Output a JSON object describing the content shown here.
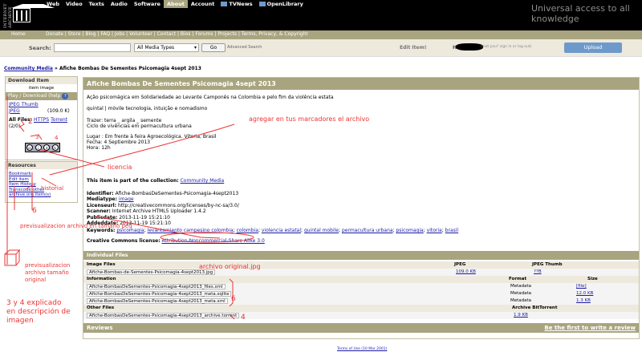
{
  "logo": {
    "vertical_text": "INTERNET ARCHIVE"
  },
  "nav": [
    "Web",
    "Video",
    "Texts",
    "Audio",
    "Software",
    "About",
    "Account",
    "TVNews",
    "OpenLibrary"
  ],
  "active_nav": "About",
  "tagline": "Universal access to all knowledge",
  "subnav": {
    "home": "Home",
    "links": "Donate | Store | Blog | FAQ | Jobs | Volunteer | Contact | Bios | Forums | Projects | Terms, Privacy, & Copyright"
  },
  "toolbar": {
    "search_label": "Search:",
    "select_value": "All Media Types",
    "go_label": "Go",
    "advanced": "Advanced Search",
    "edit_item": "Edit Item!",
    "hello": "Hello",
    "logout_hint": "(not you? sign in or log out)",
    "upload": "Upload"
  },
  "breadcrumb": {
    "link": "Community Media",
    "sep": " » ",
    "current": "Afiche Bombas De Sementes Psicomagia 4sept 2013"
  },
  "left": {
    "download_title": "Download Item",
    "item_image": "item image",
    "play_download": "Play / Download (help",
    "jpeg_thumb": "JPEG Thumb",
    "jpeg": "JPEG",
    "jpeg_size": "(109.0 K)",
    "all_files_label": "All Files:",
    "https": "HTTPS",
    "torrent": "Torrent",
    "count": "(2/0)",
    "resources_title": "Resources",
    "resources": [
      "Bookmark",
      "Edit item",
      "Item History",
      "Transcode other",
      "archive.org item(s)"
    ]
  },
  "item": {
    "title": "Afiche Bombas De Sementes Psicomagia 4sept 2013",
    "desc1": "Ação psicomágica em Solidariedade ao Levante Camponês na Colombia e pelo fim da violência estata",
    "desc2": "quintal | mòvile tecnologia, intuição e nomadismo",
    "desc3a": "Trazer: terra _ argila _ semente",
    "desc3b": "Ciclo de vivências em permacultura urbana",
    "desc4a": "Lugar : Em frente à feira Agroecológica. Vitoria, Brasil",
    "desc4b": "Fecha: 4 Septiembre 2013",
    "desc4c": "Hora: 12h",
    "collection_prefix": "This item is part of the collection:",
    "collection": "Community Media",
    "identifier_label": "Identifier:",
    "identifier": "Afiche-BombasDeSementes-Psicomagia-4sept2013",
    "mediatype_label": "Mediatype:",
    "mediatype": "image",
    "licenseurl_label": "Licenseurl:",
    "licenseurl": "http://creativecommons.org/licenses/by-nc-sa/3.0/",
    "scanner_label": "Scanner:",
    "scanner": "Internet Archive HTML5 Uploader 1.4.2",
    "publicdate_label": "Publicdate:",
    "publicdate": "2013-11-19 15:21:10",
    "addeddate_label": "Addeddate:",
    "addeddate": "2013-11-19 15:21:10",
    "keywords_label": "Keywords:",
    "keywords": [
      "psicomagia",
      "levantamiento campesino colombia",
      "colombia",
      "violencia estatal",
      "quintal mobile",
      "permacultura urbana",
      "psicomagia",
      "vitoria",
      "brasil"
    ],
    "cc_label": "Creative Commons license:",
    "cc_value": "Attribution-Noncommercial-Share Alike 3.0"
  },
  "files": {
    "header": "Individual Files",
    "image_files": "Image Files",
    "jpeg_col": "JPEG",
    "jpeg_thumb_col": "JPEG Thumb",
    "image_row": {
      "name": "Afiche-Bombas-de-Sementes-Psicomagia-4sept2013.jpg",
      "jpeg": "109.0 KB",
      "thumb": "??B"
    },
    "info_hd": "Information",
    "format_hd": "Format",
    "size_hd": "Size",
    "info_rows": [
      {
        "name": "Afiche-BombasDeSementes-Psicomagia-4sept2013_files.xml",
        "format": "Metadata",
        "size": "[file]"
      },
      {
        "name": "Afiche-BombasDeSementes-Psicomagia-4sept2013_meta.sqlite",
        "format": "Metadata",
        "size": "12.0 KB"
      },
      {
        "name": "Afiche-BombasDeSementes-Psicomagia-4sept2013_meta.xml",
        "format": "Metadata",
        "size": "1.3 KB"
      }
    ],
    "other_hd": "Other Files",
    "torrent_hd": "Archive BitTorrent",
    "other_row": {
      "name": "Afiche-BombasDeSementes-Psicomagia-4sept2013_archive.torrent",
      "size": "1.9 KB"
    }
  },
  "reviews": {
    "title": "Reviews",
    "first": "Be the first to write a review"
  },
  "footer": "Terms of Use (10 Mar 2001)",
  "annotations": {
    "marcadores": "agregar en tus marcadores el archivo",
    "licencia": "licencia",
    "historial": "historial",
    "n6": "6",
    "previs_peq": "previsualizacion archivo en tamaño peq",
    "previs_orig": "previsualizacion archivo tamaño original",
    "explicado": "3 y 4 explicado en descripción de imagen",
    "orig_jpg": "archivo original.jpg",
    "n6b": "6",
    "n4": "4",
    "n2": "2",
    "n3": "3",
    "n4b": "4"
  },
  "colors": {
    "accent": "#a8a47f",
    "annotation": "#e33",
    "header": "#000000",
    "link": "#1a1aa6"
  }
}
